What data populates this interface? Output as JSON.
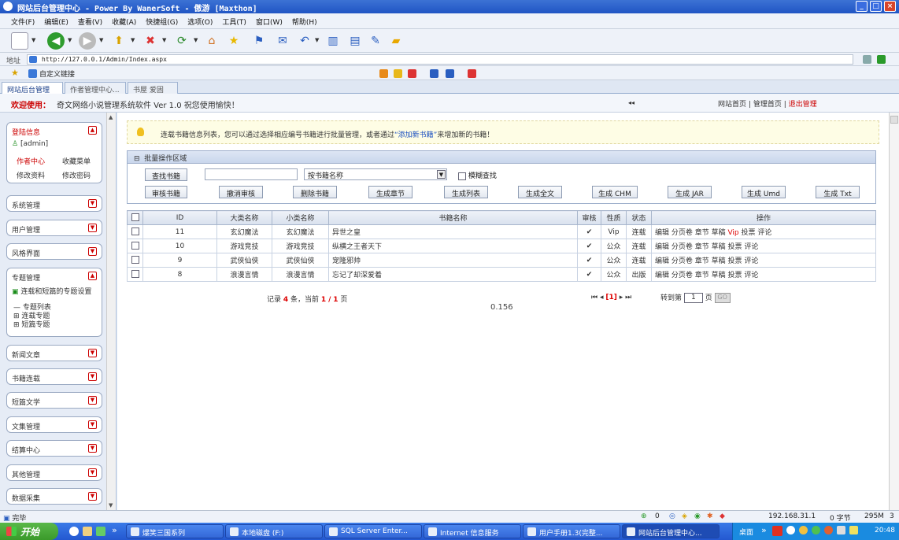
{
  "window": {
    "title": "网站后台管理中心 - Power By WanerSoft - 傲游 [Maxthon]",
    "buttons": [
      "_",
      "□",
      "×"
    ]
  },
  "menubar": {
    "items": [
      "文件(F)",
      "编辑(E)",
      "查看(V)",
      "收藏(A)",
      "快捷组(G)",
      "选项(O)",
      "工具(T)",
      "窗口(W)",
      "帮助(H)"
    ]
  },
  "toolbar": {
    "icons": [
      "new-page-icon",
      "back-icon",
      "forward-icon",
      "up-icon",
      "stop-icon",
      "refresh-icon",
      "home-icon",
      "favorites-icon",
      "groups-icon",
      "mail-icon",
      "undo-icon",
      "columns-icon",
      "layout-icon",
      "notes-icon",
      "folder-icon"
    ]
  },
  "address": {
    "label": "地址",
    "url": "http://127.0.0.1/Admin/Index.aspx"
  },
  "favorites": {
    "label": "自定义链接"
  },
  "tabs": [
    {
      "label": "网站后台管理"
    },
    {
      "label": "作者管理中心..."
    },
    {
      "label": "书屋 爱固小..."
    }
  ],
  "header": {
    "welcome": "欢迎使用：",
    "version": "奇文网络小说管理系统软件  Ver 1.0   祝您使用愉快！",
    "arrows": "◂◂",
    "links": [
      "网站首页",
      "管理首页",
      "退出管理"
    ],
    "sep": "|"
  },
  "sidebar": {
    "login": {
      "title": "登陆信息",
      "user": "[admin]",
      "links": [
        "作者中心",
        "收藏菜单",
        "修改资料",
        "修改密码"
      ]
    },
    "groups": [
      {
        "label": "系统管理"
      },
      {
        "label": "用户管理"
      },
      {
        "label": "风格界面"
      }
    ],
    "topic": {
      "title": "专题管理",
      "setting": "连载和短篇的专题设置",
      "tree": [
        "专题列表",
        "连载专题",
        "短篇专题"
      ]
    },
    "groups2": [
      {
        "label": "新闻文章"
      },
      {
        "label": "书籍连载"
      },
      {
        "label": "短篇文学"
      },
      {
        "label": "文集管理"
      },
      {
        "label": "结算中心"
      },
      {
        "label": "其他管理"
      },
      {
        "label": "数据采集"
      }
    ]
  },
  "notice": {
    "text_before": "连载书籍信息列表，您可以通过选择相应编号书籍进行批量管理，或者通过",
    "link": "“添加新书籍”",
    "text_after": "来增加新的书籍！"
  },
  "batch": {
    "title": "批量操作区域",
    "search_button": "查找书籍",
    "search_value": "",
    "search_by": "按书籍名称",
    "fuzzy": "模糊查找",
    "actions": [
      "审核书籍",
      "撤消审核",
      "删除书籍",
      "生成章节",
      "生成列表",
      "生成全文",
      "生成 CHM",
      "生成 JAR",
      "生成 Umd",
      "生成  Txt"
    ]
  },
  "table": {
    "headers": [
      "ID",
      "大类名称",
      "小类名称",
      "书籍名称",
      "审核",
      "性质",
      "状态",
      "操作"
    ],
    "rows": [
      {
        "id": "11",
        "big": "玄幻魔法",
        "small": "玄幻魔法",
        "name": "异世之皇",
        "audit": "✔",
        "nature": "Vip",
        "status": "连载",
        "ops1": "编辑 分页卷 章节 草稿",
        "vip": "Vip",
        "ops2": "投票 评论"
      },
      {
        "id": "10",
        "big": "游戏竞技",
        "small": "游戏竞技",
        "name": "纵横之王者天下",
        "audit": "✔",
        "nature": "公众",
        "status": "连载",
        "ops1": "编辑 分页卷 章节 草稿",
        "vip": "",
        "ops2": "投票 评论"
      },
      {
        "id": "9",
        "big": "武侠仙侠",
        "small": "武侠仙侠",
        "name": "宠隆邪帅",
        "audit": "✔",
        "nature": "公众",
        "status": "连载",
        "ops1": "编辑 分页卷 章节 草稿",
        "vip": "",
        "ops2": "投票 评论"
      },
      {
        "id": "8",
        "big": "浪漫言情",
        "small": "浪漫言情",
        "name": "忘记了却深爱着",
        "audit": "✔",
        "nature": "公众",
        "status": "出版",
        "ops1": "编辑 分页卷 章节 草稿",
        "vip": "",
        "ops2": "投票 评论"
      }
    ]
  },
  "pager": {
    "records_label": "记录",
    "records": "4",
    "unit": "条，当前",
    "current": "1",
    "slash": "/",
    "total": "1",
    "page_unit": "页",
    "nav_first": "⏮",
    "nav_prev": "◂",
    "nav_current": "[1]",
    "nav_next": "▸",
    "nav_last": "⏭",
    "jump_label": "转到第",
    "jump_value": "1",
    "jump_unit": "页",
    "go": "GO"
  },
  "timing": "0.156",
  "statusbar": {
    "left": "完毕",
    "count": "0",
    "ip": "192.168.31.1",
    "bytes": "0 字节",
    "mem": "295M",
    "num": "3"
  },
  "taskbar": {
    "start": "开始",
    "chevron": "»",
    "tasks": [
      "爆笑三国系列",
      "本地磁盘 (F:)",
      "SQL Server Enter...",
      "Internet 信息服务",
      "用户手册1.3(完整...",
      "网站后台管理中心..."
    ],
    "desktop": "桌面",
    "clock": "20:48"
  }
}
